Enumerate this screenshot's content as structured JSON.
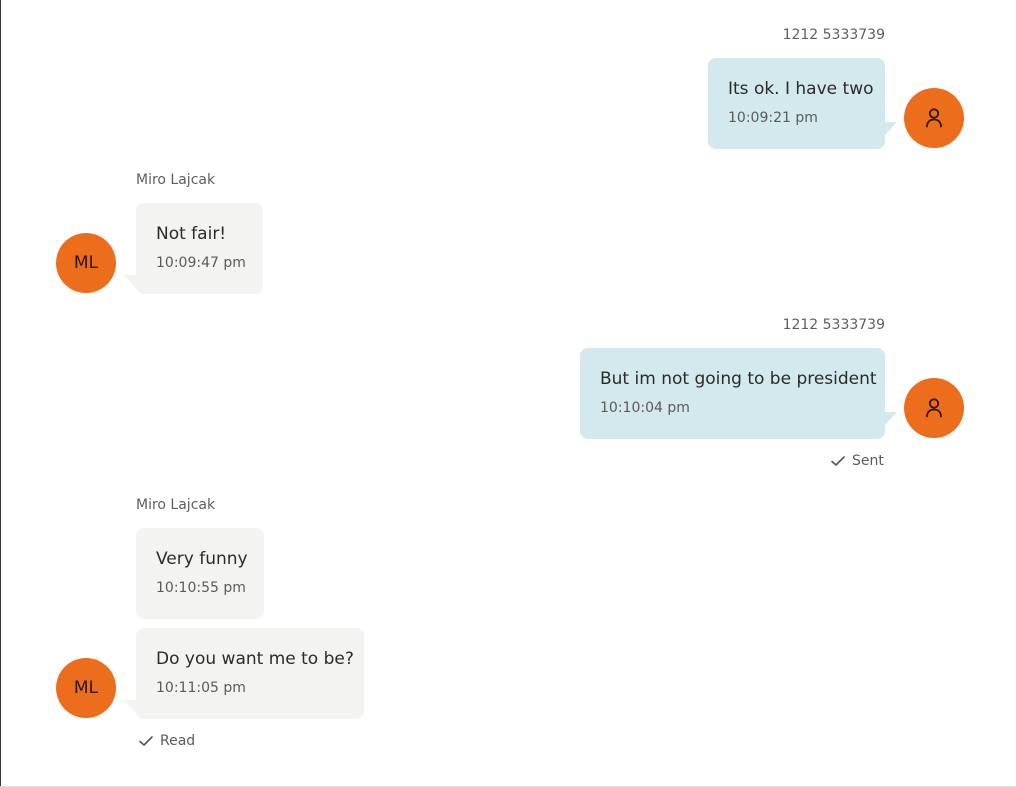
{
  "messages": [
    {
      "direction": "outgoing",
      "sender": "1212 5333739",
      "text": "Its ok. I have two",
      "time": "10:09:21 pm",
      "avatar_icon": "user-icon"
    },
    {
      "direction": "incoming",
      "sender": "Miro Lajcak",
      "text": "Not fair!",
      "time": "10:09:47 pm",
      "avatar_initials": "ML"
    },
    {
      "direction": "outgoing",
      "sender": "1212 5333739",
      "text": "But im not going to be president",
      "time": "10:10:04 pm",
      "avatar_icon": "user-icon",
      "status": "Sent"
    },
    {
      "direction": "incoming",
      "sender": "Miro Lajcak",
      "text": "Very funny",
      "time": "10:10:55 pm"
    },
    {
      "direction": "incoming",
      "text": "Do you want me to be?",
      "time": "10:11:05 pm",
      "avatar_initials": "ML",
      "status": "Read"
    }
  ],
  "colors": {
    "outgoing_bubble": "#d3e9ee",
    "incoming_bubble": "#f3f3f2",
    "avatar": "#ec6e1c"
  }
}
